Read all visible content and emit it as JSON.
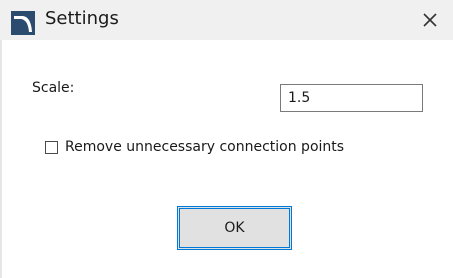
{
  "window": {
    "title": "Settings",
    "icon": "app-window-icon",
    "close_icon": "close-icon"
  },
  "form": {
    "scale_label": "Scale:",
    "scale_value": "1.5",
    "remove_points_label": "Remove unnecessary connection points",
    "remove_points_checked": false
  },
  "buttons": {
    "ok_label": "OK"
  },
  "colors": {
    "accent": "#0078d7",
    "icon_blue": "#2b4b6f"
  }
}
